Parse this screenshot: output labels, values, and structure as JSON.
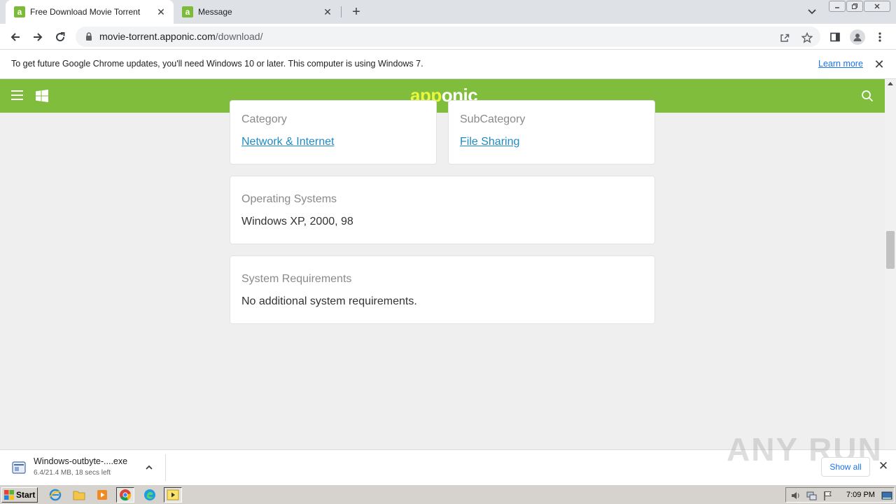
{
  "browser": {
    "tabs": [
      {
        "title": "Free Download Movie Torrent",
        "favicon": "a"
      },
      {
        "title": "Message",
        "favicon": "a"
      }
    ],
    "url": {
      "host": "movie-torrent.apponic.com",
      "path": "/download/"
    }
  },
  "infobar": {
    "message": "To get future Google Chrome updates, you'll need Windows 10 or later. This computer is using Windows 7.",
    "learn_more": "Learn more"
  },
  "site": {
    "brand_part1": "app",
    "brand_part2": "onic",
    "brand_color": "#80bd3d",
    "cards": {
      "category": {
        "label": "Category",
        "value": "Network & Internet"
      },
      "subcategory": {
        "label": "SubCategory",
        "value": "File Sharing"
      },
      "os": {
        "label": "Operating Systems",
        "value": "Windows XP, 2000, 98"
      },
      "requirements": {
        "label": "System Requirements",
        "value": "No additional system requirements."
      }
    }
  },
  "downloads": {
    "file_name": "Windows-outbyte-....exe",
    "status": "6.4/21.4 MB, 18 secs left",
    "show_all": "Show all"
  },
  "watermark": "ANY RUN",
  "taskbar": {
    "start_label": "Start",
    "clock": "7:09 PM"
  }
}
